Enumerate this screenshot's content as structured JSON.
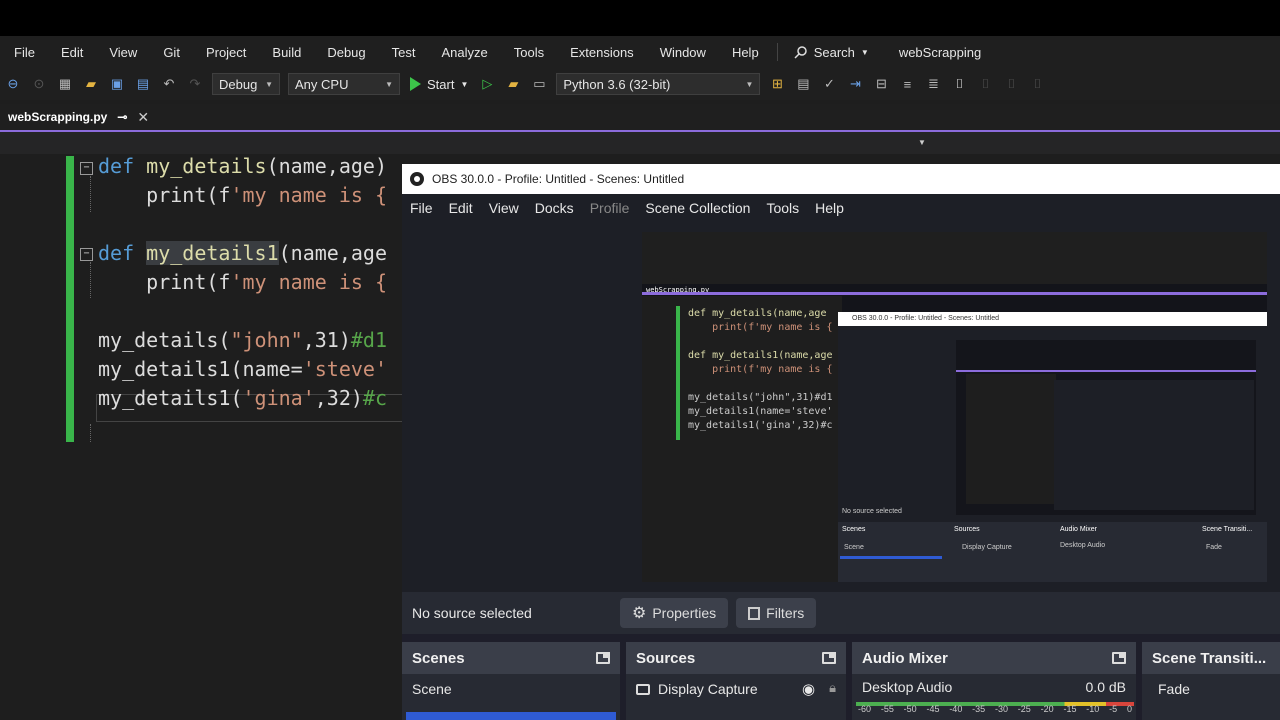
{
  "menubar": {
    "items": [
      "File",
      "Edit",
      "View",
      "Git",
      "Project",
      "Build",
      "Debug",
      "Test",
      "Analyze",
      "Tools",
      "Extensions",
      "Window",
      "Help"
    ],
    "search_label": "Search",
    "solution_name": "webScrapping"
  },
  "toolbar": {
    "config": "Debug",
    "platform": "Any CPU",
    "start_label": "Start",
    "environment": "Python 3.6 (32-bit)"
  },
  "tab": {
    "filename": "webScrapping.py",
    "pin": "⊸",
    "close": "✕"
  },
  "code": {
    "l1a": "def ",
    "l1b": "my_details",
    "l1c": "(name,age)",
    "l2a": "    print(f",
    "l2b": "'my name is {",
    "l3a": "def ",
    "l3b": "my_details1",
    "l3c": "(name,age",
    "l4a": "    print(f",
    "l4b": "'my name is {",
    "l5a": "my_details(",
    "l5b": "\"john\"",
    "l5c": ",31)",
    "l5d": "#d1",
    "l6a": "my_details1(name=",
    "l6b": "'steve'",
    "l7a": "my_details1(",
    "l7b": "'gina'",
    "l7c": ",32)",
    "l7d": "#c"
  },
  "obs": {
    "title": "OBS 30.0.0 - Profile: Untitled - Scenes: Untitled",
    "menu": [
      "File",
      "Edit",
      "View",
      "Docks",
      "Profile",
      "Scene Collection",
      "Tools",
      "Help"
    ],
    "no_source": "No source selected",
    "properties_label": "Properties",
    "filters_label": "Filters",
    "scenes_title": "Scenes",
    "scene_item": "Scene",
    "sources_title": "Sources",
    "source_item": "Display Capture",
    "audio_title": "Audio Mixer",
    "audio_item": "Desktop Audio",
    "audio_level": "0.0 dB",
    "audio_ticks": [
      "-60",
      "-55",
      "-50",
      "-45",
      "-40",
      "-35",
      "-30",
      "-25",
      "-20",
      "-15",
      "-10",
      "-5",
      "0"
    ],
    "transitions_title": "Scene Transiti...",
    "transition_item": "Fade"
  },
  "mini": {
    "code1": "def my_details(name,age",
    "code2": "    print(f'my name is {",
    "code3": "def my_details1(name,age",
    "code4": "    print(f'my name is {",
    "code5": "my_details(\"john\",31)#d1",
    "code6": "my_details1(name='steve'",
    "code7": "my_details1('gina',32)#c",
    "tab": "webScrapping.py",
    "obs_title": "OBS 30.0.0 - Profile: Untitled - Scenes: Untitled",
    "no_source": "No source selected",
    "scenes": "Scenes",
    "sources": "Sources",
    "audio": "Audio Mixer",
    "transitions": "Scene Transiti...",
    "scene": "Scene",
    "display": "Display Capture",
    "desktop": "Desktop Audio",
    "fade": "Fade"
  }
}
